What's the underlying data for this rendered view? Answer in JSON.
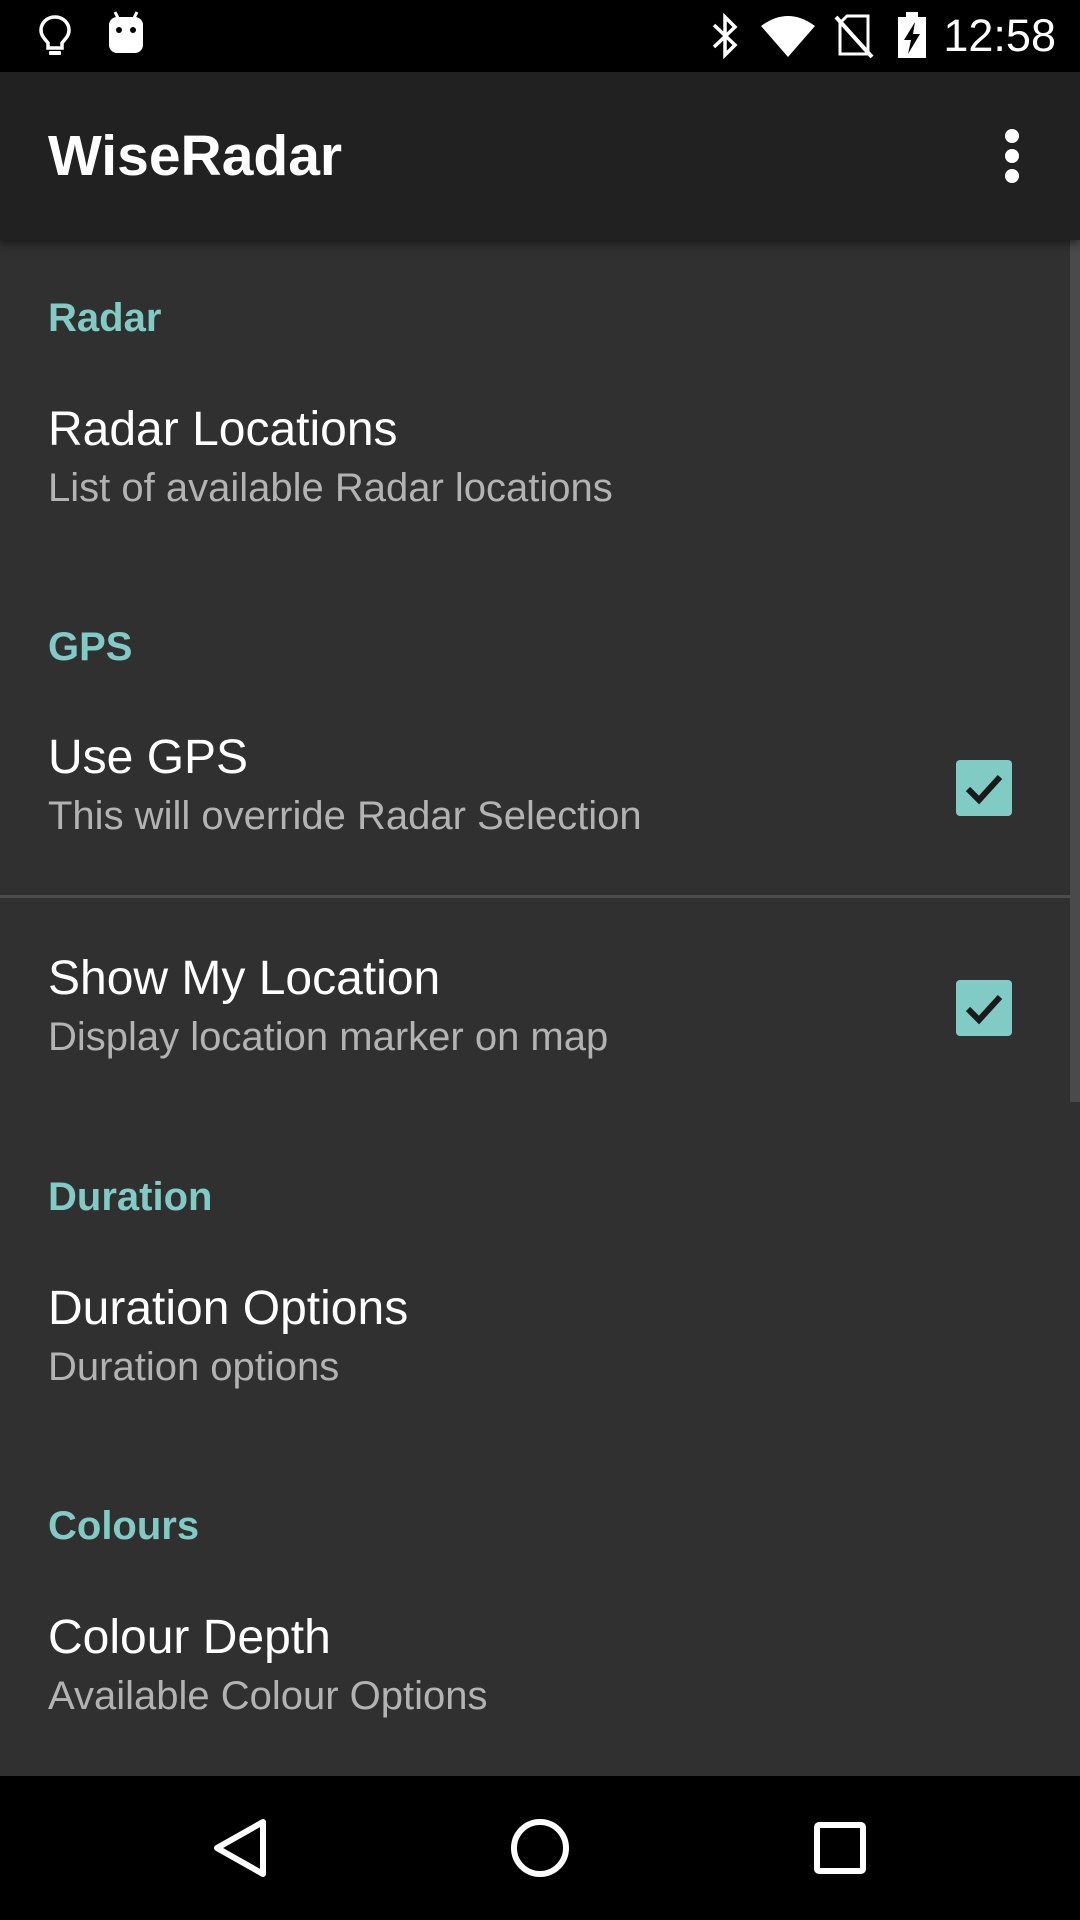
{
  "status_bar": {
    "time": "12:58",
    "left_icons": [
      "lightbulb-icon",
      "android-icon"
    ],
    "right_icons": [
      "bluetooth-icon",
      "wifi-icon",
      "no-sim-icon",
      "battery-charging-icon"
    ]
  },
  "app_bar": {
    "title": "WiseRadar",
    "overflow_icon": "more-vert-icon"
  },
  "preferences": {
    "radar": {
      "category": "Radar",
      "radar_locations": {
        "title": "Radar Locations",
        "summary": "List of available Radar locations"
      }
    },
    "gps": {
      "category": "GPS",
      "use_gps": {
        "title": "Use GPS",
        "summary": "This will override Radar Selection",
        "checked": true
      },
      "show_my_location": {
        "title": "Show My Location",
        "summary": "Display location marker on map",
        "checked": true
      }
    },
    "duration": {
      "category": "Duration",
      "duration_options": {
        "title": "Duration Options",
        "summary": "Duration options"
      }
    },
    "colours": {
      "category": "Colours",
      "colour_depth": {
        "title": "Colour Depth",
        "summary": "Available Colour Options"
      }
    }
  },
  "navigation_bar": {
    "buttons": [
      "back-icon",
      "home-icon",
      "recents-icon"
    ]
  },
  "colors": {
    "accent": "#80cbc4",
    "background": "#303030",
    "app_bar": "#212121",
    "summary_text": "#b3b3b3"
  }
}
